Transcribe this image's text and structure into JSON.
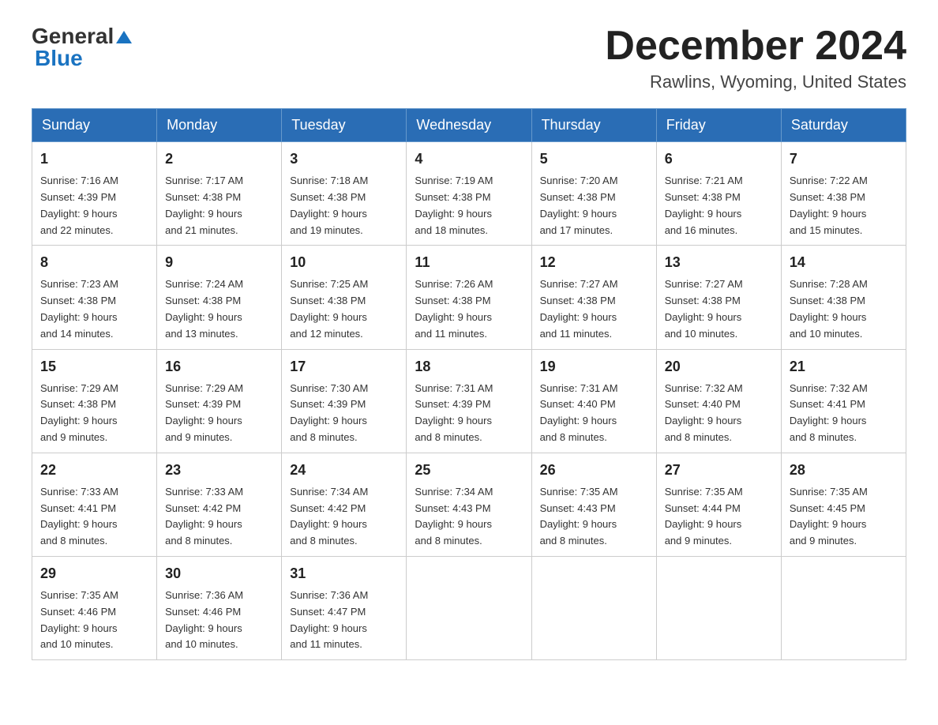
{
  "logo": {
    "general": "General",
    "blue": "Blue"
  },
  "title": {
    "month_year": "December 2024",
    "location": "Rawlins, Wyoming, United States"
  },
  "weekdays": [
    "Sunday",
    "Monday",
    "Tuesday",
    "Wednesday",
    "Thursday",
    "Friday",
    "Saturday"
  ],
  "weeks": [
    [
      {
        "day": "1",
        "sunrise": "7:16 AM",
        "sunset": "4:39 PM",
        "daylight": "9 hours and 22 minutes."
      },
      {
        "day": "2",
        "sunrise": "7:17 AM",
        "sunset": "4:38 PM",
        "daylight": "9 hours and 21 minutes."
      },
      {
        "day": "3",
        "sunrise": "7:18 AM",
        "sunset": "4:38 PM",
        "daylight": "9 hours and 19 minutes."
      },
      {
        "day": "4",
        "sunrise": "7:19 AM",
        "sunset": "4:38 PM",
        "daylight": "9 hours and 18 minutes."
      },
      {
        "day": "5",
        "sunrise": "7:20 AM",
        "sunset": "4:38 PM",
        "daylight": "9 hours and 17 minutes."
      },
      {
        "day": "6",
        "sunrise": "7:21 AM",
        "sunset": "4:38 PM",
        "daylight": "9 hours and 16 minutes."
      },
      {
        "day": "7",
        "sunrise": "7:22 AM",
        "sunset": "4:38 PM",
        "daylight": "9 hours and 15 minutes."
      }
    ],
    [
      {
        "day": "8",
        "sunrise": "7:23 AM",
        "sunset": "4:38 PM",
        "daylight": "9 hours and 14 minutes."
      },
      {
        "day": "9",
        "sunrise": "7:24 AM",
        "sunset": "4:38 PM",
        "daylight": "9 hours and 13 minutes."
      },
      {
        "day": "10",
        "sunrise": "7:25 AM",
        "sunset": "4:38 PM",
        "daylight": "9 hours and 12 minutes."
      },
      {
        "day": "11",
        "sunrise": "7:26 AM",
        "sunset": "4:38 PM",
        "daylight": "9 hours and 11 minutes."
      },
      {
        "day": "12",
        "sunrise": "7:27 AM",
        "sunset": "4:38 PM",
        "daylight": "9 hours and 11 minutes."
      },
      {
        "day": "13",
        "sunrise": "7:27 AM",
        "sunset": "4:38 PM",
        "daylight": "9 hours and 10 minutes."
      },
      {
        "day": "14",
        "sunrise": "7:28 AM",
        "sunset": "4:38 PM",
        "daylight": "9 hours and 10 minutes."
      }
    ],
    [
      {
        "day": "15",
        "sunrise": "7:29 AM",
        "sunset": "4:38 PM",
        "daylight": "9 hours and 9 minutes."
      },
      {
        "day": "16",
        "sunrise": "7:29 AM",
        "sunset": "4:39 PM",
        "daylight": "9 hours and 9 minutes."
      },
      {
        "day": "17",
        "sunrise": "7:30 AM",
        "sunset": "4:39 PM",
        "daylight": "9 hours and 8 minutes."
      },
      {
        "day": "18",
        "sunrise": "7:31 AM",
        "sunset": "4:39 PM",
        "daylight": "9 hours and 8 minutes."
      },
      {
        "day": "19",
        "sunrise": "7:31 AM",
        "sunset": "4:40 PM",
        "daylight": "9 hours and 8 minutes."
      },
      {
        "day": "20",
        "sunrise": "7:32 AM",
        "sunset": "4:40 PM",
        "daylight": "9 hours and 8 minutes."
      },
      {
        "day": "21",
        "sunrise": "7:32 AM",
        "sunset": "4:41 PM",
        "daylight": "9 hours and 8 minutes."
      }
    ],
    [
      {
        "day": "22",
        "sunrise": "7:33 AM",
        "sunset": "4:41 PM",
        "daylight": "9 hours and 8 minutes."
      },
      {
        "day": "23",
        "sunrise": "7:33 AM",
        "sunset": "4:42 PM",
        "daylight": "9 hours and 8 minutes."
      },
      {
        "day": "24",
        "sunrise": "7:34 AM",
        "sunset": "4:42 PM",
        "daylight": "9 hours and 8 minutes."
      },
      {
        "day": "25",
        "sunrise": "7:34 AM",
        "sunset": "4:43 PM",
        "daylight": "9 hours and 8 minutes."
      },
      {
        "day": "26",
        "sunrise": "7:35 AM",
        "sunset": "4:43 PM",
        "daylight": "9 hours and 8 minutes."
      },
      {
        "day": "27",
        "sunrise": "7:35 AM",
        "sunset": "4:44 PM",
        "daylight": "9 hours and 9 minutes."
      },
      {
        "day": "28",
        "sunrise": "7:35 AM",
        "sunset": "4:45 PM",
        "daylight": "9 hours and 9 minutes."
      }
    ],
    [
      {
        "day": "29",
        "sunrise": "7:35 AM",
        "sunset": "4:46 PM",
        "daylight": "9 hours and 10 minutes."
      },
      {
        "day": "30",
        "sunrise": "7:36 AM",
        "sunset": "4:46 PM",
        "daylight": "9 hours and 10 minutes."
      },
      {
        "day": "31",
        "sunrise": "7:36 AM",
        "sunset": "4:47 PM",
        "daylight": "9 hours and 11 minutes."
      },
      null,
      null,
      null,
      null
    ]
  ],
  "labels": {
    "sunrise": "Sunrise:",
    "sunset": "Sunset:",
    "daylight": "Daylight:"
  },
  "colors": {
    "header_bg": "#2a6db5",
    "header_text": "#ffffff",
    "border": "#cccccc"
  }
}
